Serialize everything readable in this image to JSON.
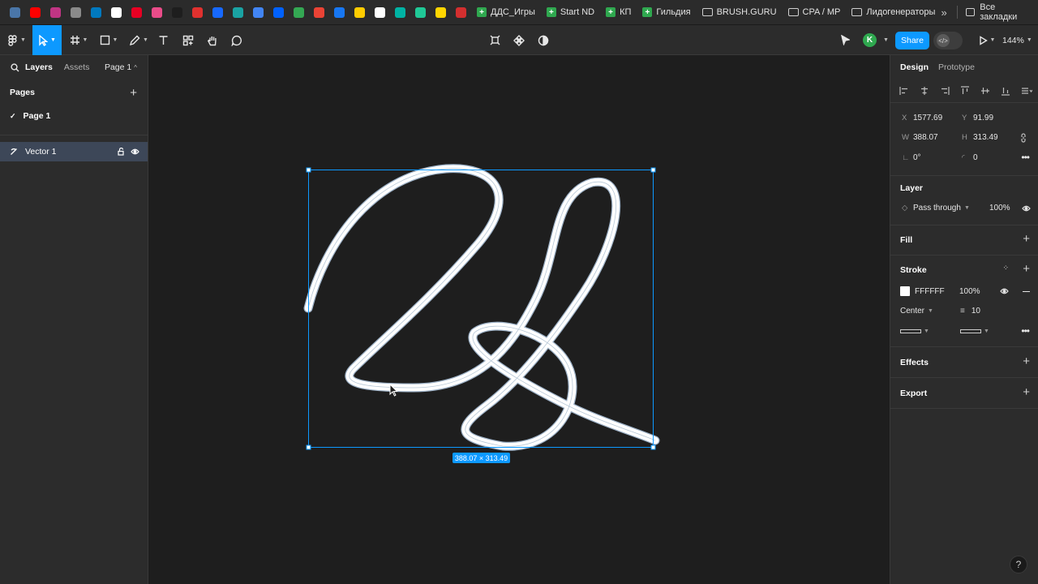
{
  "bookmarks": {
    "labels": [
      "ДДС_Игры",
      "Start ND",
      "КП",
      "Гильдия",
      "BRUSH.GURU",
      "CPA / MP",
      "Лидогенераторы"
    ],
    "all_bookmarks": "Все закладки",
    "more": "»",
    "colors": [
      "#4a76a8",
      "#ff0000",
      "#c13584",
      "#8a8a8a",
      "#0079bf",
      "#ffffff",
      "#e60023",
      "#ea4c89",
      "#1e1e1e",
      "#e0312f",
      "#1769ff",
      "#1aa3a3",
      "#4285f4",
      "#0061fe",
      "#34a853",
      "#ea4335",
      "#1877f2",
      "#ffcc00",
      "#ffffff",
      "#00b3a4",
      "#20c997",
      "#ffd600",
      "#d32f2f"
    ]
  },
  "toolbar": {
    "share_label": "Share",
    "avatar_letter": "K",
    "zoom": "144%",
    "accent": "#0d99ff"
  },
  "left_panel": {
    "tabs": [
      "Layers",
      "Assets"
    ],
    "page_switch": "Page 1",
    "pages_title": "Pages",
    "pages": [
      "Page 1"
    ],
    "layers": [
      "Vector 1"
    ]
  },
  "canvas": {
    "selection_size": "388.07 × 313.49",
    "stroke_color": "#ffffff"
  },
  "right_panel": {
    "tabs": [
      "Design",
      "Prototype"
    ],
    "x_label": "X",
    "x": "1577.69",
    "y_label": "Y",
    "y": "91.99",
    "w_label": "W",
    "w": "388.07",
    "h_label": "H",
    "h": "313.49",
    "rotation": "0°",
    "radius": "0",
    "layer_title": "Layer",
    "blend": "Pass through",
    "layer_opacity": "100%",
    "fill_title": "Fill",
    "stroke_title": "Stroke",
    "stroke_hex": "FFFFFF",
    "stroke_opacity": "100%",
    "stroke_position": "Center",
    "stroke_weight": "10",
    "effects_title": "Effects",
    "export_title": "Export"
  },
  "help": "?"
}
